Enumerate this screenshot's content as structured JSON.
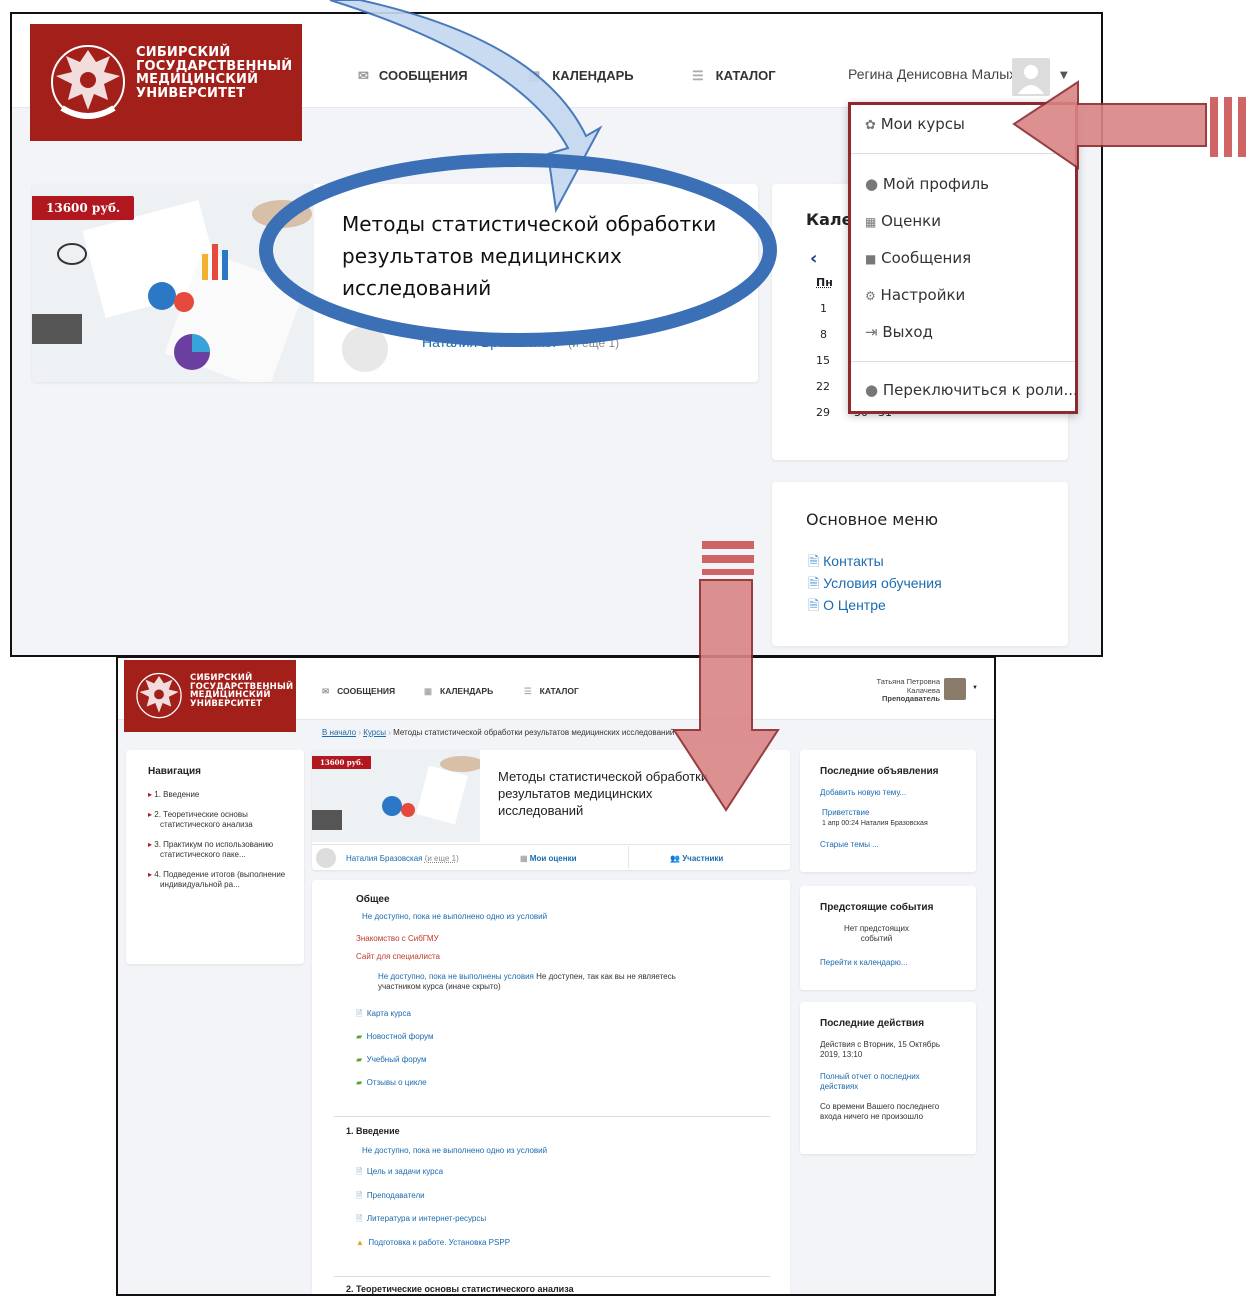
{
  "top": {
    "logo_lines": [
      "СИБИРСКИЙ",
      "ГОСУДАРСТВЕННЫЙ",
      "МЕДИЦИНСКИЙ",
      "УНИВЕРСИТЕТ"
    ],
    "nav": {
      "messages": "СООБЩЕНИЯ",
      "calendar": "КАЛЕНДАРЬ",
      "catalog": "КАТАЛОГ"
    },
    "user_name": "Регина Денисовна Малых",
    "course": {
      "price": "13600 руб.",
      "title": "Методы статистической обработки результатов медицинских исследований",
      "teacher": "Наталия Бразовская",
      "more": "(и еще 1)"
    },
    "calendar": {
      "title": "Календарь",
      "weekday": "Пн",
      "days": [
        "1",
        "8",
        "15",
        "22",
        "29"
      ],
      "extra": [
        "30",
        "31"
      ]
    },
    "main_menu": {
      "title": "Основное меню",
      "items": [
        "Контакты",
        "Условия обучения",
        "О Центре"
      ]
    },
    "dropdown": {
      "my_courses": "Мои курсы",
      "profile": "Мой профиль",
      "grades": "Оценки",
      "messages": "Сообщения",
      "settings": "Настройки",
      "logout": "Выход",
      "switch_role": "Переключиться к роли..."
    }
  },
  "bottom": {
    "nav": {
      "messages": "СООБЩЕНИЯ",
      "calendar": "КАЛЕНДАРЬ",
      "catalog": "КАТАЛОГ"
    },
    "user": {
      "first": "Татьяна Петровна",
      "last": "Калачева",
      "role": "Преподаватель"
    },
    "breadcrumb": [
      "В начало",
      "Курсы",
      "Методы статистической обработки результатов медицинских исследований"
    ],
    "course": {
      "price": "13600 руб.",
      "title": "Методы статистической обработки результатов медицинских исследований",
      "teacher": "Наталия Бразовская",
      "more": "(и еще 1)",
      "grades": "Мои оценки",
      "participants": "Участники"
    },
    "navigation": {
      "title": "Навигация",
      "items": [
        "1. Введение",
        "2. Теоретические основы статистического анализа",
        "3. Практикум по использованию статистического паке...",
        "4. Подведение итогов (выполнение индивидуальной ра..."
      ]
    },
    "general": {
      "title": "Общее",
      "restrict": "Не доступно, пока не выполнено одно из условий",
      "link1": "Знакомство с СибГМУ",
      "link2": "Сайт для специалиста",
      "restrict2a": "Не доступно, пока не выполнены условия",
      "restrict2b": "Не доступен, так как вы не являетесь",
      "restrict2c": "участником курса (иначе скрыто)",
      "resources": [
        "Карта курса",
        "Новостной форум",
        "Учебный форум",
        "Отзывы о цикле"
      ]
    },
    "intro": {
      "title": "1. Введение",
      "restrict": "Не доступно, пока не выполнено одно из условий",
      "resources": [
        "Цель и задачи курса",
        "Преподаватели",
        "Литература и интернет-ресурсы",
        "Подготовка к работе. Установка PSPP"
      ]
    },
    "section2_title": "2. Теоретические основы статистического анализа",
    "news": {
      "title": "Последние объявления",
      "add": "Добавить новую тему...",
      "post": "Приветствие",
      "post_meta": "1 апр 00:24  Наталия Бразовская",
      "old": "Старые темы ..."
    },
    "events": {
      "title": "Предстоящие события",
      "none1": "Нет предстоящих",
      "none2": "событий",
      "goto": "Перейти к календарю..."
    },
    "activity": {
      "title": "Последние действия",
      "since1": "Действия с Вторник, 15 Октябрь",
      "since2": "2019, 13:10",
      "report1": "Полный отчет о последних",
      "report2": "действиях",
      "nothing1": "Со времени Вашего последнего",
      "nothing2": "входа ничего не произошло"
    }
  },
  "colors": {
    "brand": "#a31f1a",
    "link": "#1a6bb0",
    "highlight_border": "#8e2a2e",
    "ellipse": "#3b6fb6",
    "red_arrow": "#d98585"
  }
}
